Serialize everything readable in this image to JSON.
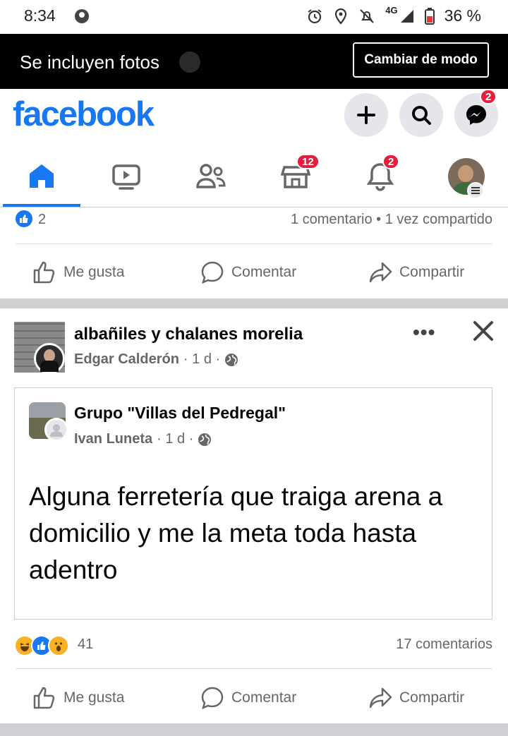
{
  "status_bar": {
    "time": "8:34",
    "network": "4G",
    "battery": "36 %"
  },
  "mode_bar": {
    "text": "Se incluyen fotos",
    "button": "Cambiar de modo"
  },
  "header": {
    "logo": "facebook",
    "messenger_badge": "2",
    "brand_color": "#1877f2"
  },
  "tabs": {
    "marketplace_badge": "12",
    "notifications_badge": "2",
    "active": "home"
  },
  "post1": {
    "likes": "2",
    "stats": "1 comentario • 1 vez compartido"
  },
  "actions": {
    "like": "Me gusta",
    "comment": "Comentar",
    "share": "Compartir"
  },
  "post2": {
    "group": "albañiles y chalanes morelia",
    "author": "Edgar Calderón",
    "time": "· 1 d ·",
    "shared": {
      "group": "Grupo \"Villas del Pedregal\"",
      "author": "Ivan Luneta",
      "time": "· 1 d ·",
      "text": "Alguna ferretería que traiga arena a domicilio y me la  meta toda hasta adentro"
    },
    "reactions_count": "41",
    "comments": "17 comentarios"
  }
}
